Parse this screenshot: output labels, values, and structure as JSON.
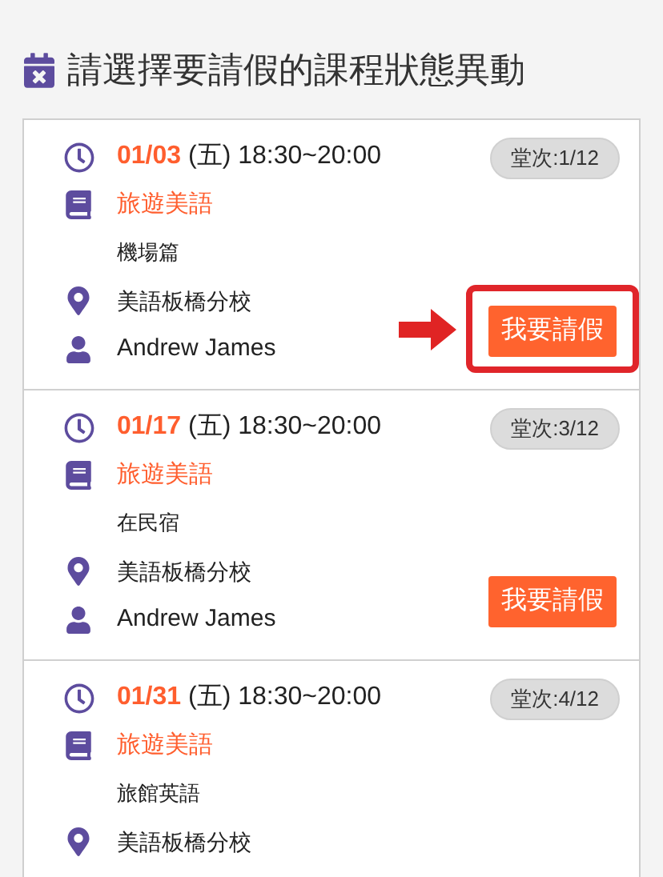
{
  "header": {
    "title": "請選擇要請假的課程狀態異動"
  },
  "lessons": [
    {
      "date": "01/03",
      "weekday": "(五)",
      "time": "18:30~20:00",
      "session": "堂次:1/12",
      "course": "旅遊美語",
      "topic": "機場篇",
      "location": "美語板橋分校",
      "teacher": "Andrew James",
      "button": "我要請假",
      "highlighted": true
    },
    {
      "date": "01/17",
      "weekday": "(五)",
      "time": "18:30~20:00",
      "session": "堂次:3/12",
      "course": "旅遊美語",
      "topic": "在民宿",
      "location": "美語板橋分校",
      "teacher": "Andrew James",
      "button": "我要請假",
      "highlighted": false
    },
    {
      "date": "01/31",
      "weekday": "(五)",
      "time": "18:30~20:00",
      "session": "堂次:4/12",
      "course": "旅遊美語",
      "topic": "旅館英語",
      "location": "美語板橋分校"
    }
  ]
}
